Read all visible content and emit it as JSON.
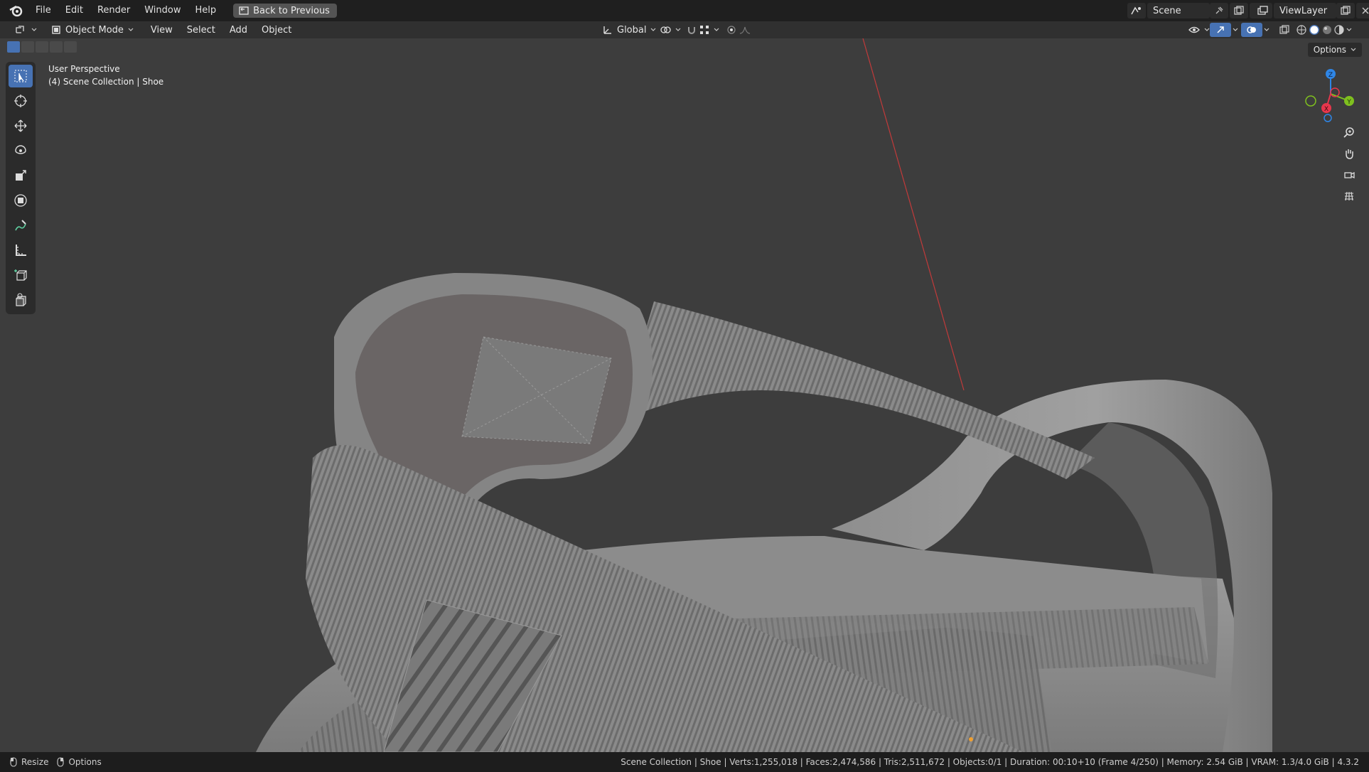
{
  "topbar": {
    "menus": [
      "File",
      "Edit",
      "Render",
      "Window",
      "Help"
    ],
    "back_button": "Back to Previous",
    "scene_label": "Scene",
    "view_layer_label": "ViewLayer"
  },
  "header": {
    "mode": "Object Mode",
    "menus": [
      "View",
      "Select",
      "Add",
      "Object"
    ],
    "transform_orientation": "Global",
    "options_label": "Options"
  },
  "viewport": {
    "perspective_label": "User Perspective",
    "collection_label": "(4) Scene Collection | Shoe",
    "gizmo_axes": [
      "Z",
      "Y",
      "X"
    ]
  },
  "toolbar": {
    "tools": [
      "select-box",
      "cursor",
      "move",
      "rotate",
      "scale",
      "transform",
      "annotate",
      "measure",
      "add-cube",
      "add-object"
    ]
  },
  "statusbar": {
    "left_items": [
      "Resize",
      "Options"
    ],
    "info": "Scene Collection | Shoe | Verts:1,255,018 | Faces:2,474,586 | Tris:2,511,672 | Objects:0/1 | Duration: 00:10+10 (Frame 4/250) | Memory: 2.54 GiB | VRAM: 1.3/4.0 GiB | 4.3.2"
  },
  "colors": {
    "accent": "#4772b3",
    "viewport_bg": "#3d3d3d",
    "axis_x": "#e8364c",
    "axis_y": "#7fc01f",
    "axis_z": "#2f86e6"
  }
}
